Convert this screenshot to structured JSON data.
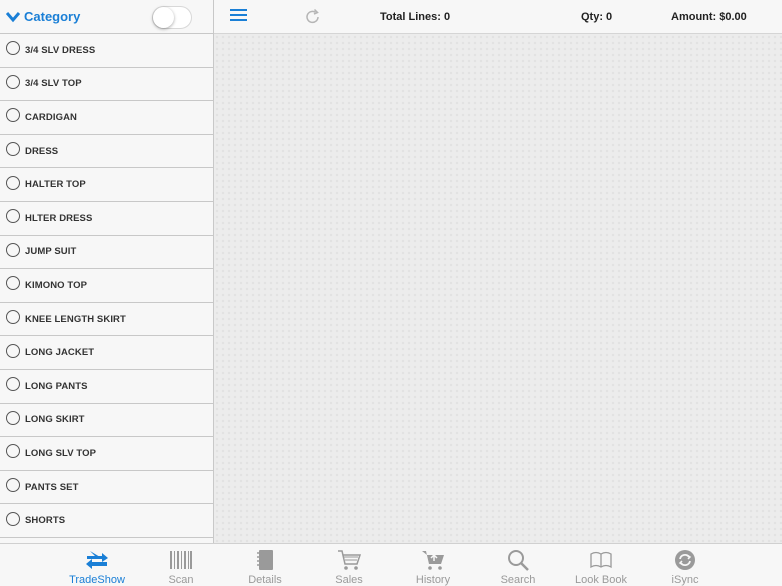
{
  "sidebar": {
    "title": "Category",
    "items": [
      {
        "label": "3/4 SLV DRESS"
      },
      {
        "label": "3/4 SLV TOP"
      },
      {
        "label": "CARDIGAN"
      },
      {
        "label": "DRESS"
      },
      {
        "label": "HALTER TOP"
      },
      {
        "label": "HLTER DRESS"
      },
      {
        "label": "JUMP SUIT"
      },
      {
        "label": "KIMONO TOP"
      },
      {
        "label": "KNEE LENGTH SKIRT"
      },
      {
        "label": "LONG JACKET"
      },
      {
        "label": "LONG PANTS"
      },
      {
        "label": "LONG SKIRT"
      },
      {
        "label": "LONG SLV TOP"
      },
      {
        "label": "PANTS SET"
      },
      {
        "label": "SHORTS"
      },
      {
        "label": ""
      }
    ]
  },
  "topbar": {
    "total_lines": "Total Lines:  0",
    "qty": "Qty: 0",
    "amount": "Amount: $0.00"
  },
  "tabs": [
    {
      "label": "TradeShow",
      "icon": "tradeshow-arrows-icon",
      "active": true
    },
    {
      "label": "Scan",
      "icon": "barcode-icon"
    },
    {
      "label": "Details",
      "icon": "notebook-icon"
    },
    {
      "label": "Sales",
      "icon": "cart-icon"
    },
    {
      "label": "History",
      "icon": "cart-history-icon"
    },
    {
      "label": "Search",
      "icon": "search-icon"
    },
    {
      "label": "Look Book",
      "icon": "book-icon"
    },
    {
      "label": "iSync",
      "icon": "sync-icon"
    }
  ],
  "colors": {
    "accent": "#1a7fd6",
    "inactive": "#9a9a9a"
  }
}
